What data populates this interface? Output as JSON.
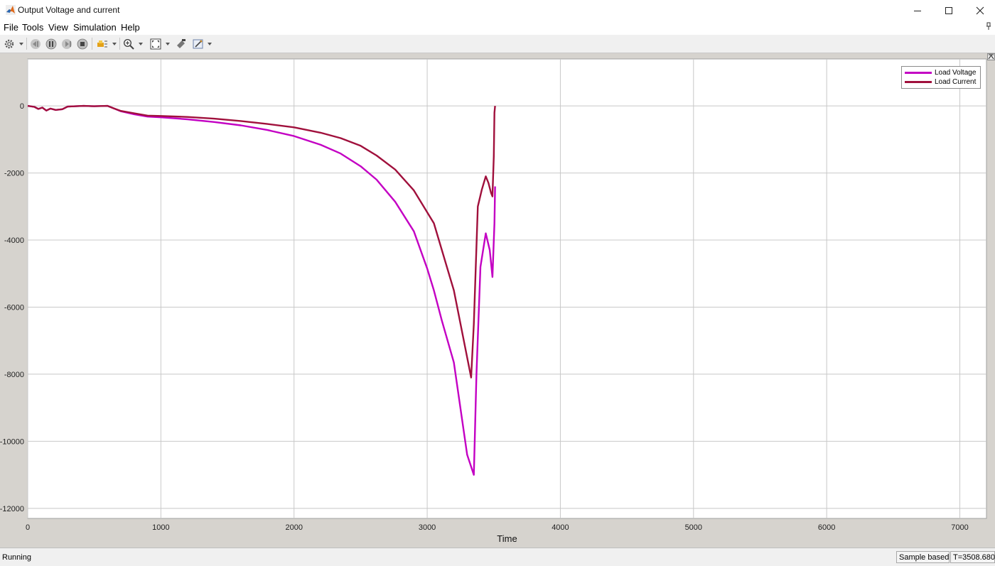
{
  "window": {
    "title": "Output Voltage and current",
    "accent": "#1b4fa0"
  },
  "menu": {
    "file": "File",
    "tools": "Tools",
    "view": "View",
    "simulation": "Simulation",
    "help": "Help"
  },
  "toolbar": {
    "icons": [
      "gear-icon",
      "step-back-icon",
      "pause-icon",
      "step-forward-icon",
      "stop-icon",
      "highlight-icon",
      "zoom-in-icon",
      "fit-to-view-icon",
      "style-icon",
      "properties-icon"
    ]
  },
  "status": {
    "state": "Running",
    "mode": "Sample based",
    "time": "T=3508.680"
  },
  "chart_data": {
    "type": "line",
    "xlabel": "Time",
    "ylabel": "",
    "xlim": [
      0,
      7200
    ],
    "ylim": [
      -12300,
      1400
    ],
    "xticks": [
      0,
      1000,
      2000,
      3000,
      4000,
      5000,
      6000,
      7000
    ],
    "yticks": [
      0,
      -2000,
      -4000,
      -6000,
      -8000,
      -10000,
      -12000
    ],
    "grid": true,
    "legend_position": "top-right",
    "series": [
      {
        "name": "Load Voltage",
        "color": "#c300c3",
        "x": [
          0,
          50,
          80,
          110,
          140,
          170,
          210,
          260,
          300,
          360,
          420,
          500,
          600,
          650,
          700,
          800,
          900,
          1000,
          1200,
          1400,
          1600,
          1800,
          2000,
          2200,
          2350,
          2500,
          2620,
          2760,
          2900,
          3000,
          3050,
          3110,
          3200,
          3300,
          3350,
          3370,
          3400,
          3440,
          3470,
          3490,
          3505,
          3510
        ],
        "y": [
          0,
          -30,
          -90,
          -50,
          -140,
          -80,
          -120,
          -100,
          -20,
          -10,
          0,
          -10,
          0,
          -80,
          -160,
          -250,
          -320,
          -340,
          -400,
          -480,
          -580,
          -720,
          -900,
          -1160,
          -1420,
          -1800,
          -2200,
          -2860,
          -3740,
          -4850,
          -5500,
          -6400,
          -7650,
          -10400,
          -11000,
          -8000,
          -4800,
          -3800,
          -4300,
          -5100,
          -3500,
          -2400
        ]
      },
      {
        "name": "Load Current",
        "color": "#a0103c",
        "x": [
          0,
          50,
          80,
          110,
          140,
          170,
          210,
          260,
          300,
          360,
          420,
          500,
          600,
          650,
          700,
          800,
          900,
          1000,
          1200,
          1400,
          1600,
          1800,
          2000,
          2200,
          2350,
          2500,
          2620,
          2760,
          2900,
          3050,
          3200,
          3330,
          3350,
          3380,
          3410,
          3440,
          3460,
          3480,
          3490,
          3500,
          3505,
          3510
        ],
        "y": [
          0,
          -30,
          -90,
          -50,
          -140,
          -80,
          -120,
          -100,
          -20,
          -10,
          0,
          -10,
          0,
          -80,
          -150,
          -220,
          -290,
          -300,
          -330,
          -380,
          -450,
          -540,
          -640,
          -800,
          -960,
          -1190,
          -1480,
          -1900,
          -2520,
          -3500,
          -5500,
          -8100,
          -6500,
          -3000,
          -2500,
          -2100,
          -2300,
          -2600,
          -2700,
          -1500,
          -200,
          0
        ]
      }
    ]
  }
}
